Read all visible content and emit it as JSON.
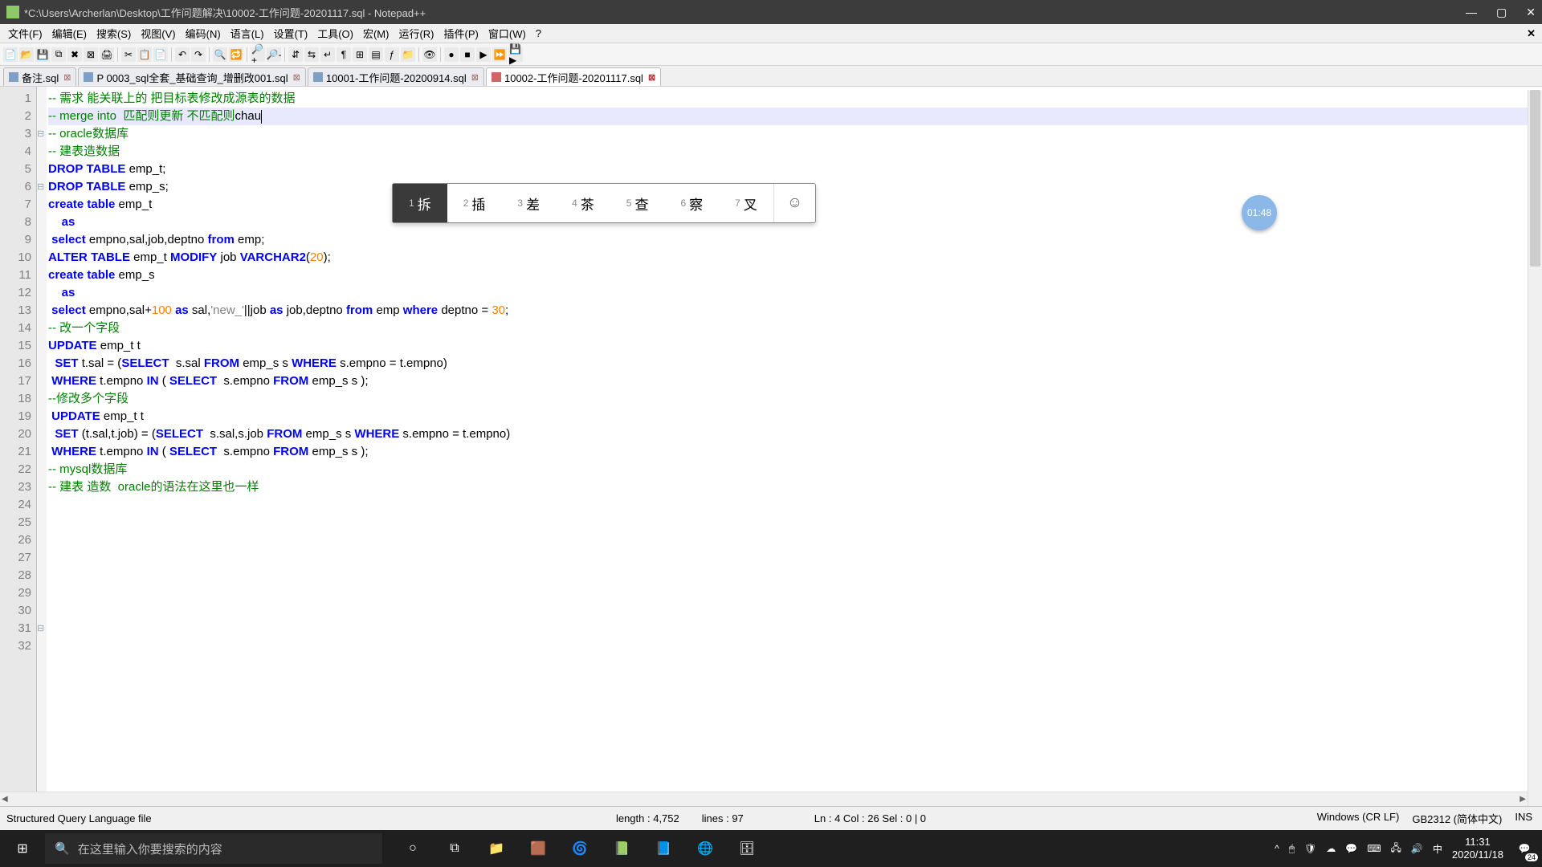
{
  "window": {
    "title": "*C:\\Users\\Archerlan\\Desktop\\工作问题解决\\10002-工作问题-20201117.sql - Notepad++"
  },
  "menu": {
    "items": [
      "文件(F)",
      "编辑(E)",
      "搜索(S)",
      "视图(V)",
      "编码(N)",
      "语言(L)",
      "设置(T)",
      "工具(O)",
      "宏(M)",
      "运行(R)",
      "插件(P)",
      "窗口(W)",
      "?"
    ]
  },
  "tabs": [
    {
      "label": "备注.sql",
      "dirty": false
    },
    {
      "label": "P 0003_sql全套_基础查询_增删改001.sql",
      "dirty": false
    },
    {
      "label": "10001-工作问题-20200914.sql",
      "dirty": false
    },
    {
      "label": "10002-工作问题-20201117.sql",
      "dirty": true,
      "active": true
    }
  ],
  "code": {
    "lines": [
      "",
      "",
      "-- 需求 能关联上的 把目标表修改成源表的数据",
      "-- merge into  匹配则更新 不匹配则chau",
      "",
      "-- oracle数据库",
      "-- 建表造数据",
      "DROP TABLE emp_t;",
      "DROP TABLE emp_s;",
      "",
      "create table emp_t",
      "    as",
      " select empno,sal,job,deptno from emp;",
      "ALTER TABLE emp_t MODIFY job VARCHAR2(20);",
      "",
      "create table emp_s",
      "    as",
      " select empno,sal+100 as sal,'new_'||job as job,deptno from emp where deptno = 30;",
      "",
      "-- 改一个字段",
      "UPDATE emp_t t",
      "  SET t.sal = (SELECT  s.sal FROM emp_s s WHERE s.empno = t.empno)",
      " WHERE t.empno IN ( SELECT  s.empno FROM emp_s s );",
      "--修改多个字段",
      " UPDATE emp_t t",
      "  SET (t.sal,t.job) = (SELECT  s.sal,s.job FROM emp_s s WHERE s.empno = t.empno)",
      " WHERE t.empno IN ( SELECT  s.empno FROM emp_s s );",
      "",
      "",
      "",
      "-- mysql数据库",
      "-- 建表 造数  oracle的语法在这里也一样"
    ],
    "fold_marks": {
      "3": "⊟",
      "6": "⊟",
      "31": "⊟"
    },
    "current_line": 4
  },
  "ime": {
    "candidates": [
      {
        "n": "1",
        "w": "拆"
      },
      {
        "n": "2",
        "w": "插"
      },
      {
        "n": "3",
        "w": "差"
      },
      {
        "n": "4",
        "w": "茶"
      },
      {
        "n": "5",
        "w": "查"
      },
      {
        "n": "6",
        "w": "察"
      },
      {
        "n": "7",
        "w": "叉"
      }
    ]
  },
  "timer": {
    "value": "01:48"
  },
  "status": {
    "filetype": "Structured Query Language file",
    "length": "length : 4,752",
    "lines": "lines : 97",
    "pos": "Ln : 4    Col : 26    Sel : 0 | 0",
    "eol": "Windows (CR LF)",
    "encoding": "GB2312 (简体中文)",
    "mode": "INS"
  },
  "taskbar": {
    "search_placeholder": "在这里输入你要搜索的内容",
    "clock_time": "11:31",
    "clock_date": "2020/11/18",
    "notif_count": "24"
  }
}
